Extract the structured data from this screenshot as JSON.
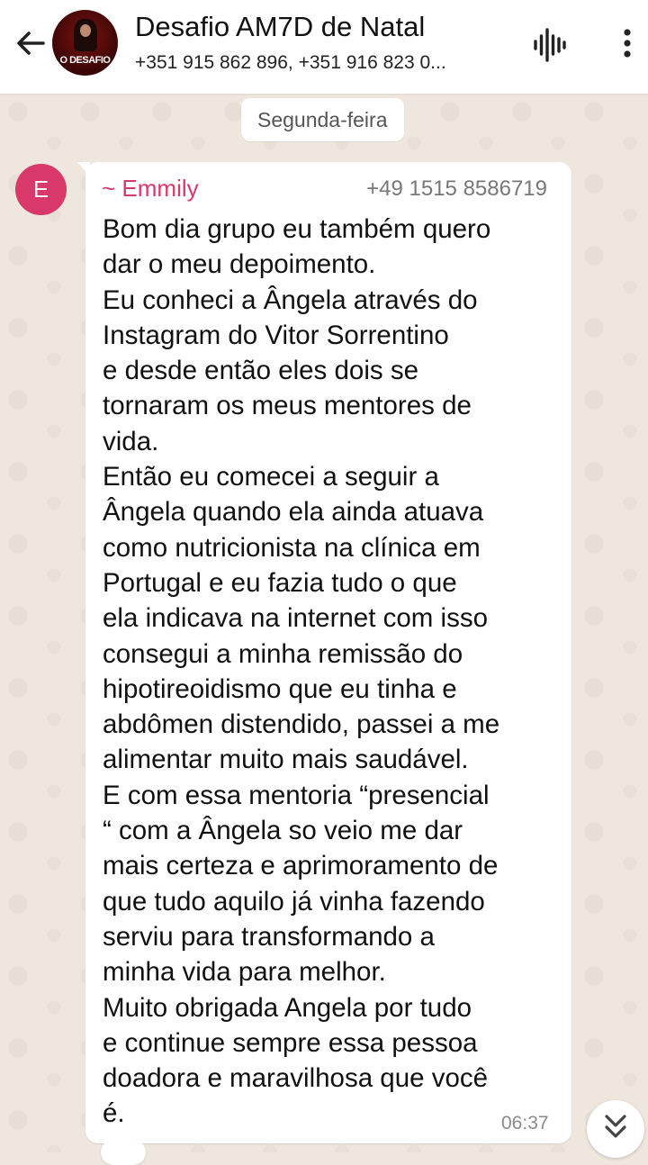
{
  "header": {
    "title": "Desafio AM7D de Natal",
    "subtitle": "+351 915 862 896, +351 916 823 0...",
    "avatar_label": "O DESAFIO",
    "icons": [
      "arrow-back-icon",
      "voice-chat-icon",
      "more-vert-icon"
    ]
  },
  "date_chip": "Segunda-feira",
  "message": {
    "avatar_letter": "E",
    "sender": "~ Emmily",
    "phone": "+49 1515 8586719",
    "text": "Bom dia grupo eu também quero\ndar o meu depoimento.\nEu conheci a Ângela através do\nInstagram do Vitor Sorrentino\ne desde então eles dois se\ntornaram os meus mentores de\nvida.\nEntão eu comecei a seguir a\nÂngela quando ela ainda atuava\ncomo nutricionista na clínica em\nPortugal e eu fazia tudo o que\nela indicava na internet com isso\nconsegui a minha remissão do\nhipotireoidismo que eu tinha e\nabdômen distendido, passei a me\nalimentar muito mais saudável.\nE com essa mentoria “presencial\n“ com a Ângela so veio me dar\nmais certeza e aprimoramento de\nque tudo aquilo já vinha fazendo\nserviu para transformando a\nminha vida para melhor.\nMuito obrigada Angela por tudo\ne continue sempre essa pessoa\ndoadora e maravilhosa que você\né.",
    "time": "06:37"
  },
  "colors": {
    "sender_accent": "#d9386b",
    "wallpaper": "#efe7de",
    "bubble": "#ffffff"
  },
  "scroll_button_icon": "double-chevron-down-icon"
}
